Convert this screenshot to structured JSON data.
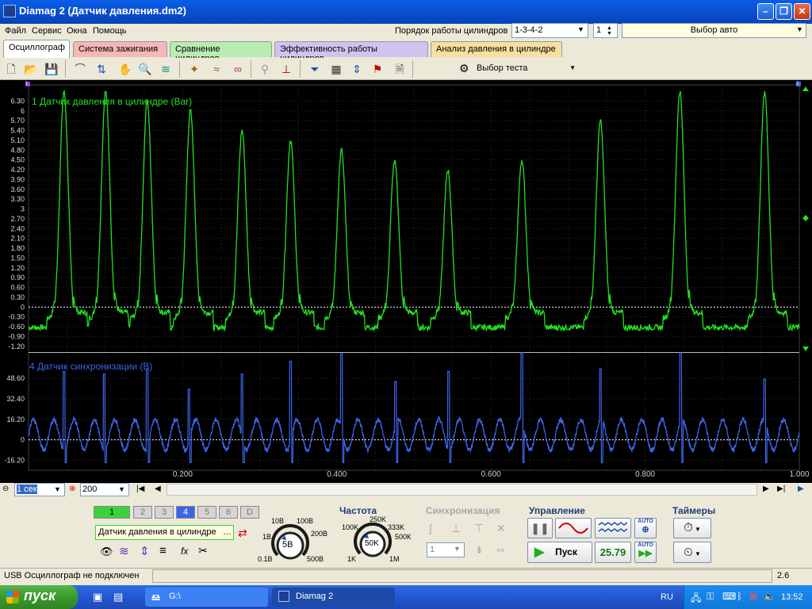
{
  "window": {
    "title": "Diamag 2 (Датчик давления.dm2)"
  },
  "menu": {
    "items": [
      "Файл",
      "Сервис",
      "Окна",
      "Помощь"
    ]
  },
  "header": {
    "cylinder_order_label": "Порядок работы цилиндров",
    "cylinder_order_value": "1-3-4-2",
    "spinner_value": "1",
    "vehicle_select": "Выбор авто"
  },
  "tabs": [
    "Осциллограф",
    "Система зажигания",
    "Сравнение цилиндров",
    "Эффективность работы цилиндров",
    "Анализ давления в цилиндре"
  ],
  "toolbar": {
    "test_select": "Выбор теста",
    "marker_left": "1",
    "marker_right": "2"
  },
  "colors": {
    "channel1": "#22e022",
    "channel4": "#3d64e8",
    "grid": "#2a2a2a",
    "background": "#000000"
  },
  "chart_data": [
    {
      "type": "line",
      "title": "1 Датчик давления в цилиндре (Bar)",
      "ylabel": "Bar",
      "ylim": [
        -1.35,
        6.6
      ],
      "yticks": [
        6.3,
        6.0,
        5.7,
        5.4,
        5.1,
        4.8,
        4.5,
        4.2,
        3.9,
        3.6,
        3.3,
        3,
        2.7,
        2.4,
        2.1,
        1.8,
        1.5,
        1.2,
        0.9,
        0.6,
        0.3,
        0,
        -0.3,
        -0.6,
        -0.9,
        -1.2
      ],
      "ytick_labels": [
        "6.30",
        "6",
        "5.70",
        "5.40",
        "5.10",
        "4.80",
        "4.50",
        "4.20",
        "3.90",
        "3.60",
        "3.30",
        "3",
        "2.70",
        "2.40",
        "2.10",
        "1.80",
        "1.50",
        "1.20",
        "0.90",
        "0.60",
        "0.30",
        "0",
        "-0.30",
        "-0.60",
        "-0.90",
        "-1.20"
      ],
      "xlim": [
        0,
        1.0
      ],
      "baseline": -0.62,
      "peaks": [
        {
          "x": 0.046,
          "y": 6.6
        },
        {
          "x": 0.1,
          "y": 6.6
        },
        {
          "x": 0.154,
          "y": 6.3
        },
        {
          "x": 0.21,
          "y": 6.0
        },
        {
          "x": 0.277,
          "y": 5.4
        },
        {
          "x": 0.34,
          "y": 5.1
        },
        {
          "x": 0.406,
          "y": 4.8
        },
        {
          "x": 0.475,
          "y": 4.5
        },
        {
          "x": 0.544,
          "y": 4.2
        },
        {
          "x": 0.64,
          "y": 4.5
        },
        {
          "x": 0.742,
          "y": 5.7
        },
        {
          "x": 0.845,
          "y": 6.6
        },
        {
          "x": 0.955,
          "y": 6.6
        }
      ]
    },
    {
      "type": "line",
      "title": "4 Датчик синхронизации (В)",
      "ylabel": "В",
      "ylim": [
        -24,
        68
      ],
      "yticks": [
        48.6,
        32.4,
        16.2,
        0,
        -16.2
      ],
      "ytick_labels": [
        "48.60",
        "32.40",
        "16.20",
        "0",
        "-16.20"
      ],
      "xlim": [
        0,
        1.0
      ],
      "xticks": [
        0.2,
        0.4,
        0.6,
        0.8,
        1.0
      ],
      "xtick_labels": [
        "0.200",
        "0.400",
        "0.600",
        "0.800",
        "1.000"
      ],
      "oscillation_period": 0.0263,
      "oscillation_range": [
        -8,
        16
      ],
      "spikes": [
        {
          "x": 0.046,
          "y": 54
        },
        {
          "x": 0.098,
          "y": 52
        },
        {
          "x": 0.154,
          "y": 56
        },
        {
          "x": 0.208,
          "y": 40
        },
        {
          "x": 0.277,
          "y": 52
        },
        {
          "x": 0.34,
          "y": 62
        },
        {
          "x": 0.406,
          "y": 68
        },
        {
          "x": 0.476,
          "y": 46
        },
        {
          "x": 0.545,
          "y": 54
        },
        {
          "x": 0.64,
          "y": 90
        },
        {
          "x": 0.742,
          "y": 56
        },
        {
          "x": 0.846,
          "y": 90
        },
        {
          "x": 0.955,
          "y": 48
        }
      ]
    }
  ],
  "bottom": {
    "timebase_value": "1 сек",
    "zoom_value": "200",
    "channels": [
      "1",
      "2",
      "3",
      "4",
      "5",
      "6",
      "D"
    ],
    "channel_select": "Датчик давления в цилиндре",
    "voltage_dial": {
      "center": "5В",
      "labels": [
        "10В",
        "100В",
        "1В",
        "200В",
        "0.1В",
        "500В"
      ]
    },
    "freq_title": "Частота",
    "freq_dial": {
      "center": "50K",
      "labels": [
        "250K",
        "100K",
        "333K",
        "500К",
        "1K",
        "1M"
      ]
    },
    "sync_title": "Синхронизация",
    "sync_value": "1",
    "control_title": "Управление",
    "start_label": "Пуск",
    "rpm_value": "25.79",
    "auto_label": "AUTO",
    "timers_title": "Таймеры"
  },
  "status": {
    "left": "USB Осциллограф не подключен",
    "right": "2.6"
  },
  "taskbar": {
    "start": "пуск",
    "items": [
      "G:\\",
      "Diamag 2"
    ],
    "lang": "RU",
    "clock": "13:52"
  }
}
